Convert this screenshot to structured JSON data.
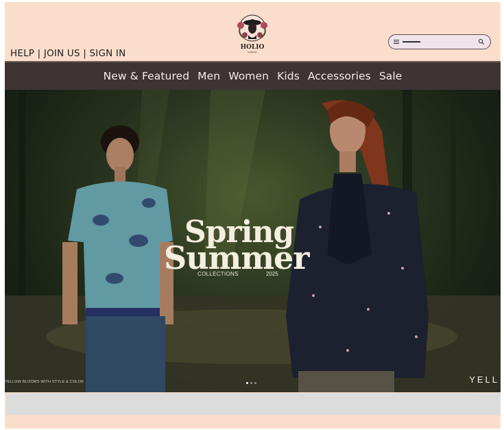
{
  "header": {
    "links": [
      "HELP",
      "JOIN US",
      "SIGN IN"
    ],
    "separator": "|",
    "logo": {
      "name": "HOLIO",
      "tagline": "FASHION"
    },
    "search": {
      "placeholder": ""
    }
  },
  "nav": {
    "items": [
      "New & Featured",
      "Men",
      "Women",
      "Kids",
      "Accessories",
      "Sale"
    ]
  },
  "hero": {
    "title_line1": "Spring",
    "title_line2": "Summer",
    "subtitle": "COLLECTIONS",
    "year": "2025",
    "tagline": "YELLOW BLOOMS WITH STYLE & COLOR",
    "ticker": "YELL",
    "carousel": {
      "slides": 3,
      "active": 1
    }
  },
  "colors": {
    "page_bg": "#fadecb",
    "nav_bg": "#3d3433",
    "nav_text": "#f3eee8",
    "search_bg": "#efe3ec",
    "band": "#dcdcdc"
  },
  "icons": [
    "menu-icon",
    "search-icon",
    "logo-emblem"
  ]
}
